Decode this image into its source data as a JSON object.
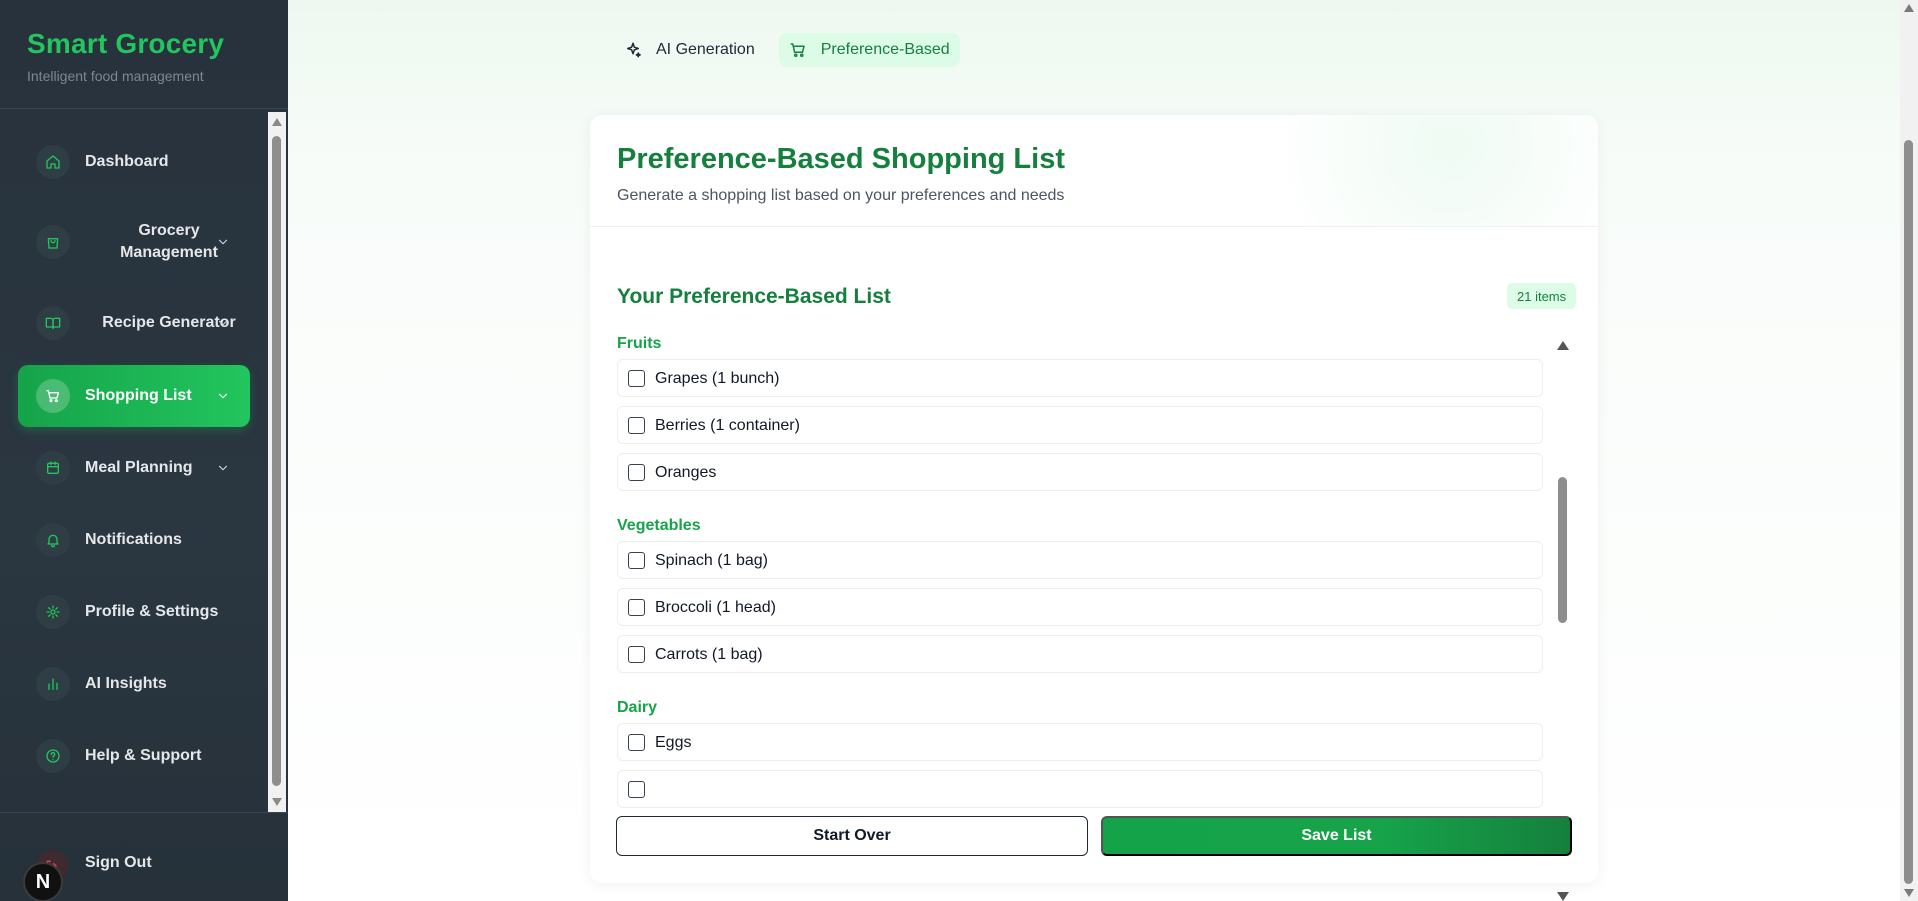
{
  "brand": {
    "title": "Smart Grocery",
    "subtitle": "Intelligent food management"
  },
  "sidebar": {
    "items": [
      {
        "label": "Dashboard",
        "icon": "home-icon",
        "active": false,
        "has_chevron": false
      },
      {
        "label": "Grocery Management",
        "icon": "shopping-bag-icon",
        "active": false,
        "has_chevron": true
      },
      {
        "label": "Recipe Generator",
        "icon": "book-icon",
        "active": false,
        "has_chevron": true
      },
      {
        "label": "Shopping List",
        "icon": "cart-icon",
        "active": true,
        "has_chevron": true
      },
      {
        "label": "Meal Planning",
        "icon": "calendar-icon",
        "active": false,
        "has_chevron": true
      },
      {
        "label": "Notifications",
        "icon": "bell-icon",
        "active": false,
        "has_chevron": false
      },
      {
        "label": "Profile & Settings",
        "icon": "gear-icon",
        "active": false,
        "has_chevron": false
      },
      {
        "label": "AI Insights",
        "icon": "bar-chart-icon",
        "active": false,
        "has_chevron": false
      },
      {
        "label": "Help & Support",
        "icon": "help-circle-icon",
        "active": false,
        "has_chevron": false
      }
    ],
    "signout_label": "Sign Out",
    "badge_letter": "N"
  },
  "tabs": [
    {
      "label": "AI Generation",
      "icon": "sparkles-icon",
      "active": false
    },
    {
      "label": "Preference-Based",
      "icon": "cart-icon",
      "active": true
    }
  ],
  "card": {
    "title": "Preference-Based Shopping List",
    "subtitle": "Generate a shopping list based on your preferences and needs",
    "list_title": "Your Preference-Based List",
    "item_count": "21 items"
  },
  "categories": [
    {
      "name": "Fruits",
      "items": [
        "Grapes (1 bunch)",
        "Berries (1 container)",
        "Oranges"
      ]
    },
    {
      "name": "Vegetables",
      "items": [
        "Spinach (1 bag)",
        "Broccoli (1 head)",
        "Carrots (1 bag)"
      ]
    },
    {
      "name": "Dairy",
      "items": [
        "Eggs",
        ""
      ]
    }
  ],
  "actions": {
    "start_over_label": "Start Over",
    "save_label": "Save List"
  },
  "colors": {
    "brand_green": "#22c55e",
    "dark_green": "#15803d",
    "sidebar_bg": "#27323c"
  }
}
